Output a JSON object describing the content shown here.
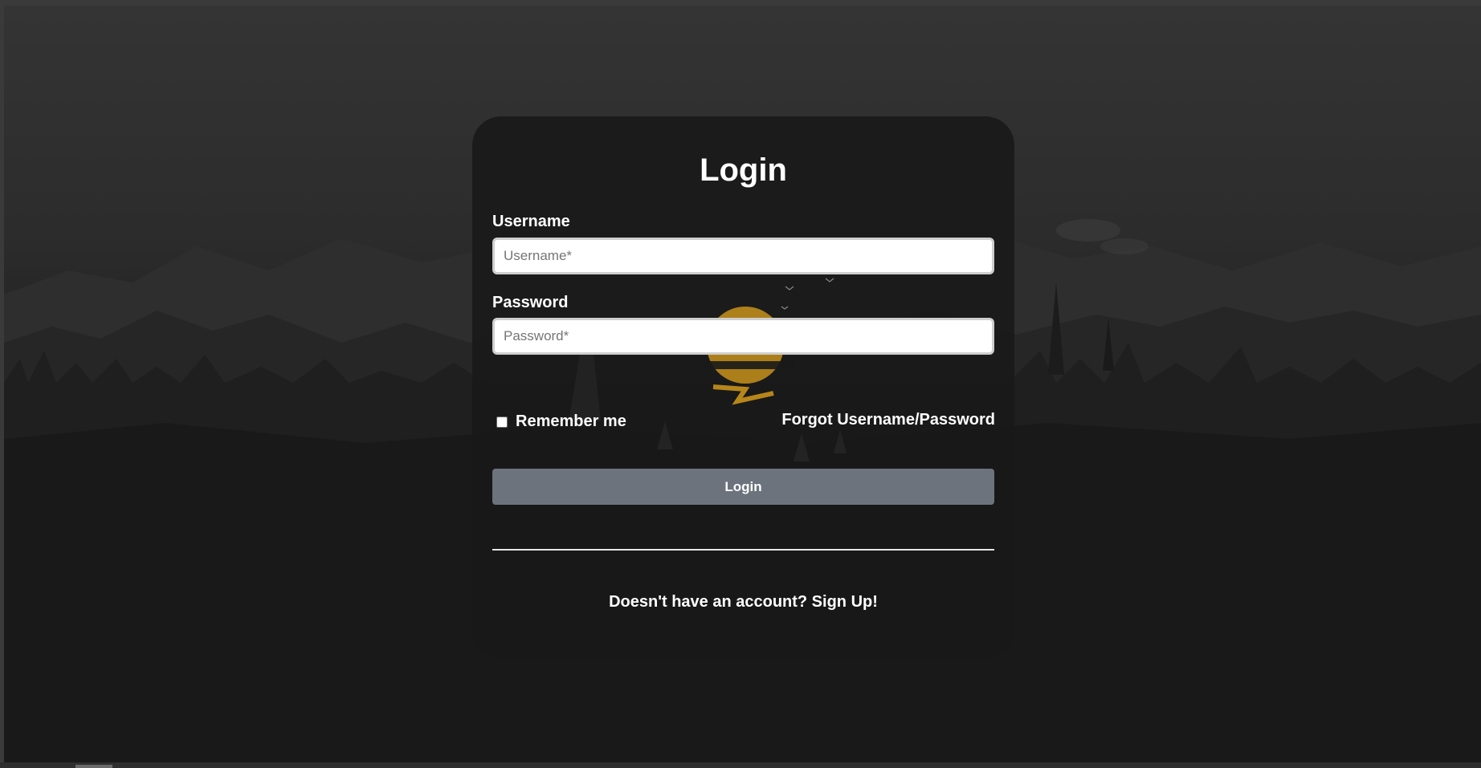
{
  "page": {
    "background_color": "#2c2c2c",
    "card_color": "#181818",
    "accent_color": "#e6a21a"
  },
  "login_form": {
    "title": "Login",
    "username_label": "Username",
    "username_placeholder": "Username*",
    "username_value": "",
    "password_label": "Password",
    "password_placeholder": "Password*",
    "password_value": "",
    "remember_label": "Remember me",
    "remember_checked": false,
    "forgot_link": "Forgot Username/Password",
    "login_button": "Login",
    "login_button_color": "#6c737d",
    "signup_prompt": "Doesn't have an account? Sign Up!"
  }
}
